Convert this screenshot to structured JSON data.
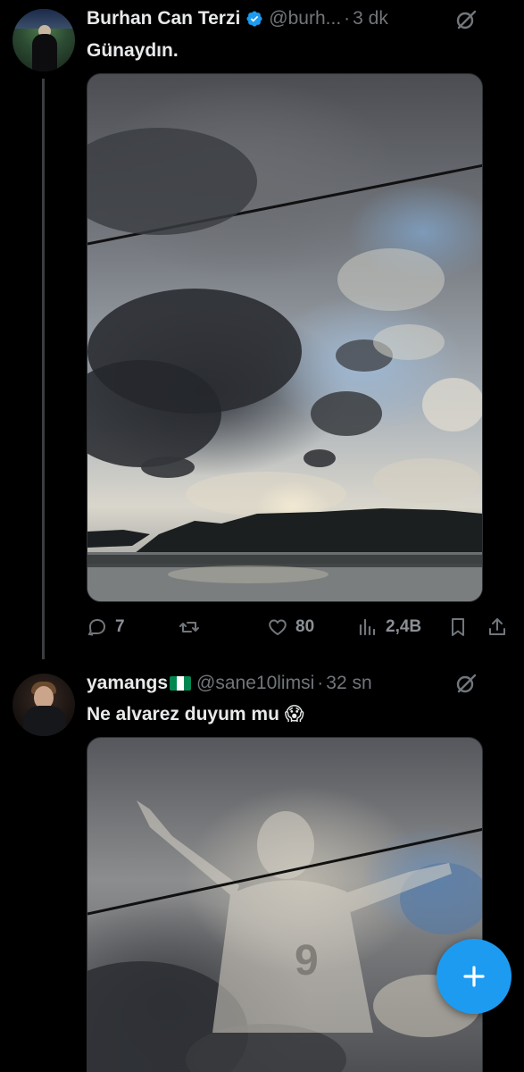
{
  "tweets": [
    {
      "author_name": "Burhan Can Terzi",
      "handle": "@burh...",
      "separator": "·",
      "time": "3 dk",
      "text": "Günaydın.",
      "replies": "7",
      "retweets": "",
      "likes": "80",
      "views": "2,4B"
    },
    {
      "author_name": "yamangs",
      "handle": "@sane10limsi",
      "separator": "·",
      "time": "32 sn",
      "text": "Ne alvarez duyum mu 😱"
    }
  ],
  "icons": {
    "verified": "verified-badge-icon",
    "grok": "grok-icon",
    "reply": "reply-icon",
    "retweet": "retweet-icon",
    "like": "heart-icon",
    "views": "views-icon",
    "bookmark": "bookmark-icon",
    "share": "share-icon",
    "compose": "plus-icon"
  },
  "colors": {
    "background": "#000000",
    "accent": "#1d9bf0",
    "secondary_text": "#71767b"
  }
}
